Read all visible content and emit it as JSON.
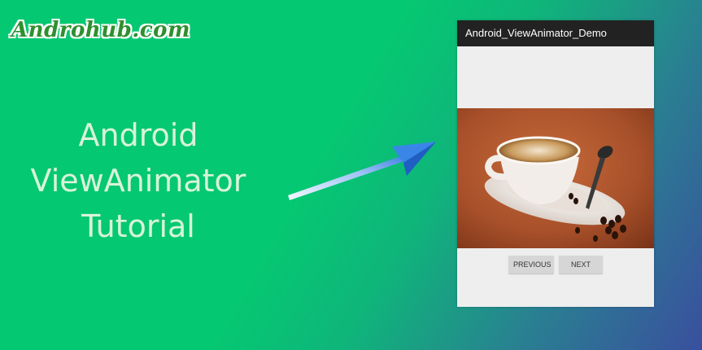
{
  "brand": {
    "text": "Androhub.com"
  },
  "headline": {
    "lines": [
      "Android",
      "ViewAnimator",
      "Tutorial"
    ]
  },
  "app": {
    "title": "Android_ViewAnimator_Demo",
    "image_subject": "coffee-cup",
    "buttons": {
      "previous": "PREVIOUS",
      "next": "NEXT"
    }
  },
  "colors": {
    "background_start": "#05c872",
    "background_end": "#3a4f9e",
    "action_bar": "#222222",
    "headline_text": "#d8f3da"
  }
}
